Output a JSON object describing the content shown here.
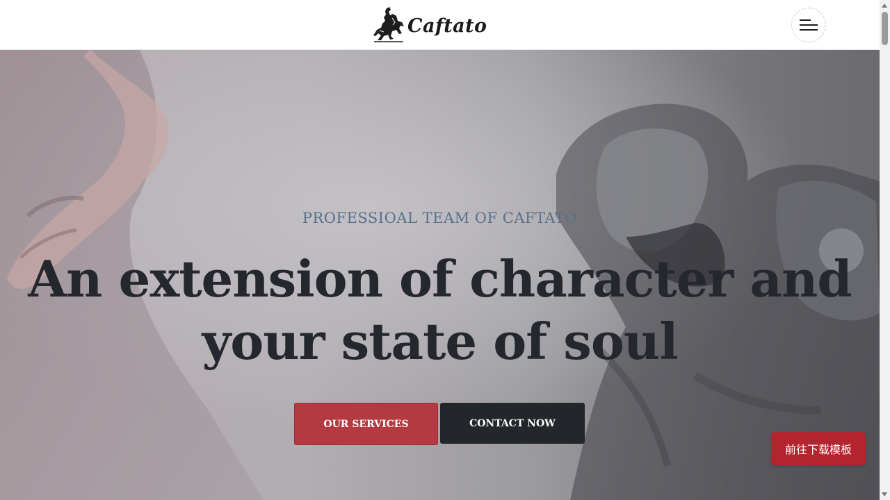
{
  "header": {
    "logo_text": "Caftato",
    "logo_icon": "horse-rider-icon",
    "menu_icon": "hamburger-menu-icon"
  },
  "hero": {
    "eyebrow": "PROFESSIOAL TEAM OF CAFTATO",
    "headline_line1": "An extension of character and",
    "headline_line2": "your state of soul",
    "primary_button": "OUR SERVICES",
    "secondary_button": "CONTACT NOW"
  },
  "floating": {
    "download_label": "前往下载模板"
  },
  "colors": {
    "accent": "#b23a40",
    "dark": "#23272c",
    "eyebrow": "#58708a",
    "download": "#b5232e"
  }
}
